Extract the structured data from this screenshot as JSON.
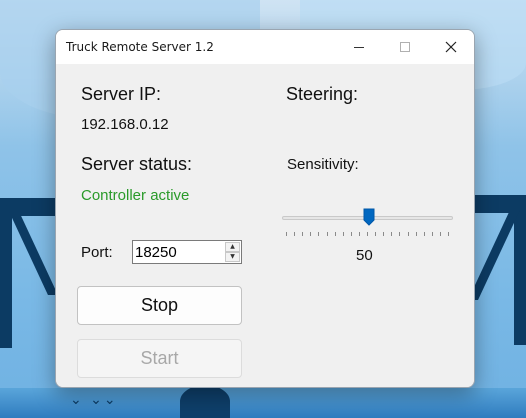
{
  "window": {
    "title": "Truck Remote Server 1.2"
  },
  "server": {
    "ip_heading": "Server IP:",
    "ip_value": "192.168.0.12",
    "status_heading": "Server status:",
    "status_value": "Controller active",
    "status_color": "#2a9a2a"
  },
  "port": {
    "label": "Port:",
    "value": "18250"
  },
  "buttons": {
    "stop": "Stop",
    "start": "Start"
  },
  "steering": {
    "heading": "Steering:",
    "sensitivity_label": "Sensitivity:",
    "value": "50",
    "value_fraction": 0.5,
    "accent_color": "#0067c0"
  },
  "icons": {
    "minimize": "minimize-icon",
    "maximize": "maximize-icon",
    "close": "close-icon",
    "spin_up": "chevron-up-icon",
    "spin_down": "chevron-down-icon"
  }
}
